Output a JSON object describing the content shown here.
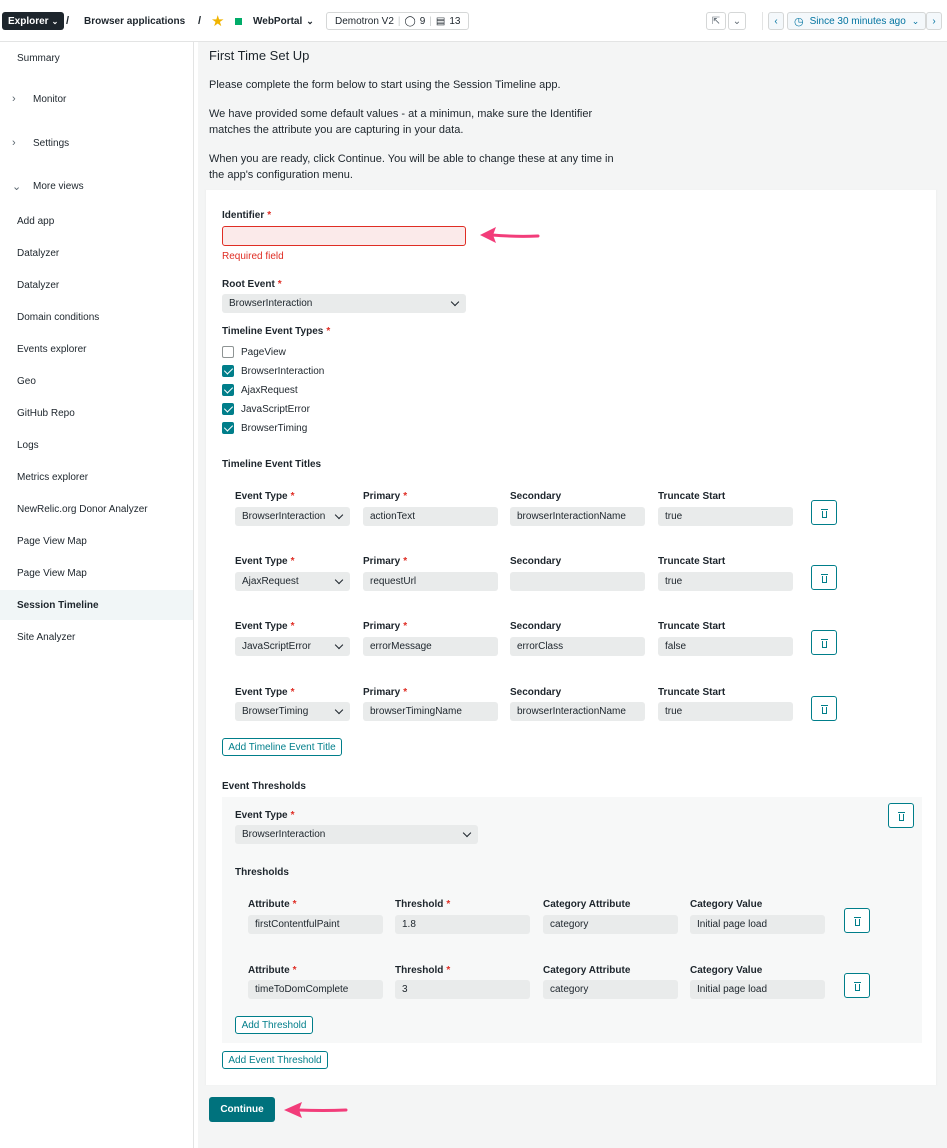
{
  "topbar": {
    "explorer": "Explorer",
    "sep": "/",
    "browser_apps": "Browser applications",
    "app_name": "WebPortal",
    "env": "Demotron V2",
    "tags_count": "9",
    "entities_count": "13",
    "time_range": "Since 30 minutes ago"
  },
  "sidebar": {
    "items": [
      {
        "label": "Summary"
      },
      {
        "label": "Monitor"
      },
      {
        "label": "Settings"
      },
      {
        "label": "More views"
      },
      {
        "label": "Add app"
      },
      {
        "label": "Datalyzer"
      },
      {
        "label": "Datalyzer"
      },
      {
        "label": "Domain conditions"
      },
      {
        "label": "Events explorer"
      },
      {
        "label": "Geo"
      },
      {
        "label": "GitHub Repo"
      },
      {
        "label": "Logs"
      },
      {
        "label": "Metrics explorer"
      },
      {
        "label": "NewRelic.org Donor Analyzer"
      },
      {
        "label": "Page View Map"
      },
      {
        "label": "Page View Map"
      },
      {
        "label": "Session Timeline"
      },
      {
        "label": "Site Analyzer"
      }
    ]
  },
  "main": {
    "title": "First Time Set Up",
    "p1": "Please complete the form below to start using the Session Timeline app.",
    "p2a": "We have provided some default values - at a minimun, make sure the Identifier",
    "p2b": "matches the attribute you are capturing in your data.",
    "p3a": "When you are ready, click Continue. You will be able to change these at any time in",
    "p3b": "the app's configuration menu.",
    "required_mark": "*",
    "identifier_label": "Identifier",
    "identifier_value": "",
    "identifier_error": "Required field",
    "root_event_label": "Root Event",
    "root_event_value": "BrowserInteraction",
    "timeline_types_label": "Timeline Event Types",
    "timeline_types": [
      {
        "label": "PageView",
        "checked": false
      },
      {
        "label": "BrowserInteraction",
        "checked": true
      },
      {
        "label": "AjaxRequest",
        "checked": true
      },
      {
        "label": "JavaScriptError",
        "checked": true
      },
      {
        "label": "BrowserTiming",
        "checked": true
      }
    ],
    "titles_label": "Timeline Event Titles",
    "col_event_type": "Event Type",
    "col_primary": "Primary",
    "col_secondary": "Secondary",
    "col_truncate": "Truncate Start",
    "title_rows": [
      {
        "event_type": "BrowserInteraction",
        "primary": "actionText",
        "secondary": "browserInteractionName",
        "truncate": "true"
      },
      {
        "event_type": "AjaxRequest",
        "primary": "requestUrl",
        "secondary": "",
        "truncate": "true"
      },
      {
        "event_type": "JavaScriptError",
        "primary": "errorMessage",
        "secondary": "errorClass",
        "truncate": "false"
      },
      {
        "event_type": "BrowserTiming",
        "primary": "browserTimingName",
        "secondary": "browserInteractionName",
        "truncate": "true"
      }
    ],
    "add_title_btn": "Add Timeline Event Title",
    "thresholds_section_label": "Event Thresholds",
    "threshold_event_type_label": "Event Type",
    "threshold_event_type_value": "BrowserInteraction",
    "thresholds_label": "Thresholds",
    "col_attribute": "Attribute",
    "col_threshold": "Threshold",
    "col_cat_attr": "Category Attribute",
    "col_cat_value": "Category Value",
    "threshold_rows": [
      {
        "attribute": "firstContentfulPaint",
        "threshold": "1.8",
        "cat_attr": "category",
        "cat_value": "Initial page load"
      },
      {
        "attribute": "timeToDomComplete",
        "threshold": "3",
        "cat_attr": "category",
        "cat_value": "Initial page load"
      }
    ],
    "add_threshold_btn": "Add Threshold",
    "add_event_threshold_btn": "Add Event Threshold",
    "continue_btn": "Continue"
  },
  "colors": {
    "accent": "#007e8a",
    "error": "#df2d24",
    "annotation_arrow": "#f23d7a"
  }
}
